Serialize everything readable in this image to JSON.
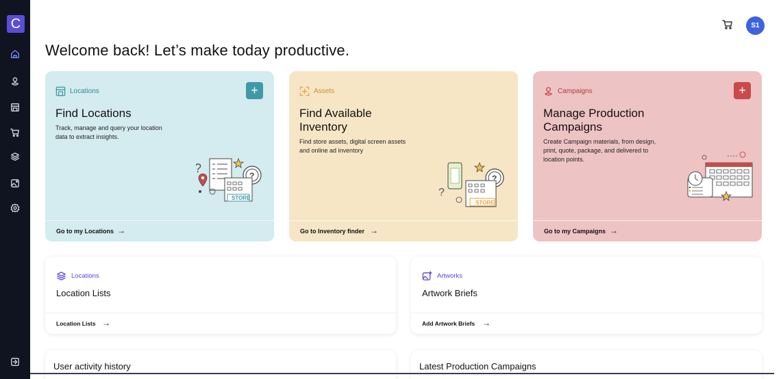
{
  "app": {
    "logo_letter": "C",
    "avatar_initials": "S1"
  },
  "header": {
    "welcome": "Welcome back! Let’s make today productive."
  },
  "sidebar": {
    "items": [
      {
        "icon": "home-icon"
      },
      {
        "icon": "location-pin-icon"
      },
      {
        "icon": "store-icon"
      },
      {
        "icon": "cart-icon"
      },
      {
        "icon": "layers-icon"
      },
      {
        "icon": "image-icon"
      },
      {
        "icon": "settings-icon"
      }
    ],
    "logout_icon": "logout-icon"
  },
  "cards": {
    "locations": {
      "tag": "Locations",
      "title": "Find Locations",
      "description": "Track, manage and query your location data to extract insights.",
      "link": "Go to my Locations",
      "illustration_label": "STORE",
      "colors": {
        "bg": "#d4ebef",
        "accent": "#3f9aa6"
      }
    },
    "assets": {
      "tag": "Assets",
      "title_line1": "Find Available",
      "title_line2": "Inventory",
      "description": "Find store assets, digital screen assets and online ad inventory",
      "link": "Go to Inventory finder",
      "illustration_label": "STORE",
      "colors": {
        "bg": "#f6e6c6",
        "accent": "#e8a13a"
      }
    },
    "campaigns": {
      "tag": "Campaigns",
      "title_line1": "Manage Production",
      "title_line2": "Campaigns",
      "description": "Create Campaign materials, from design, print, quote, package, and delivered to location points.",
      "link": "Go to my Campaigns",
      "colors": {
        "bg": "#eec3c3",
        "accent": "#c94a4a"
      }
    }
  },
  "small_cards": {
    "location_lists": {
      "tag": "Locations",
      "title": "Location Lists",
      "link": "Location Lists"
    },
    "artworks": {
      "tag": "Artworks",
      "title": "Artwork Briefs",
      "link": "Add Artwork Briefs"
    }
  },
  "bottom_cards": {
    "activity": {
      "title": "User activity history"
    },
    "production": {
      "title": "Latest Production Campaigns"
    }
  },
  "symbols": {
    "arrow": "→",
    "plus": "+",
    "question": "?"
  }
}
